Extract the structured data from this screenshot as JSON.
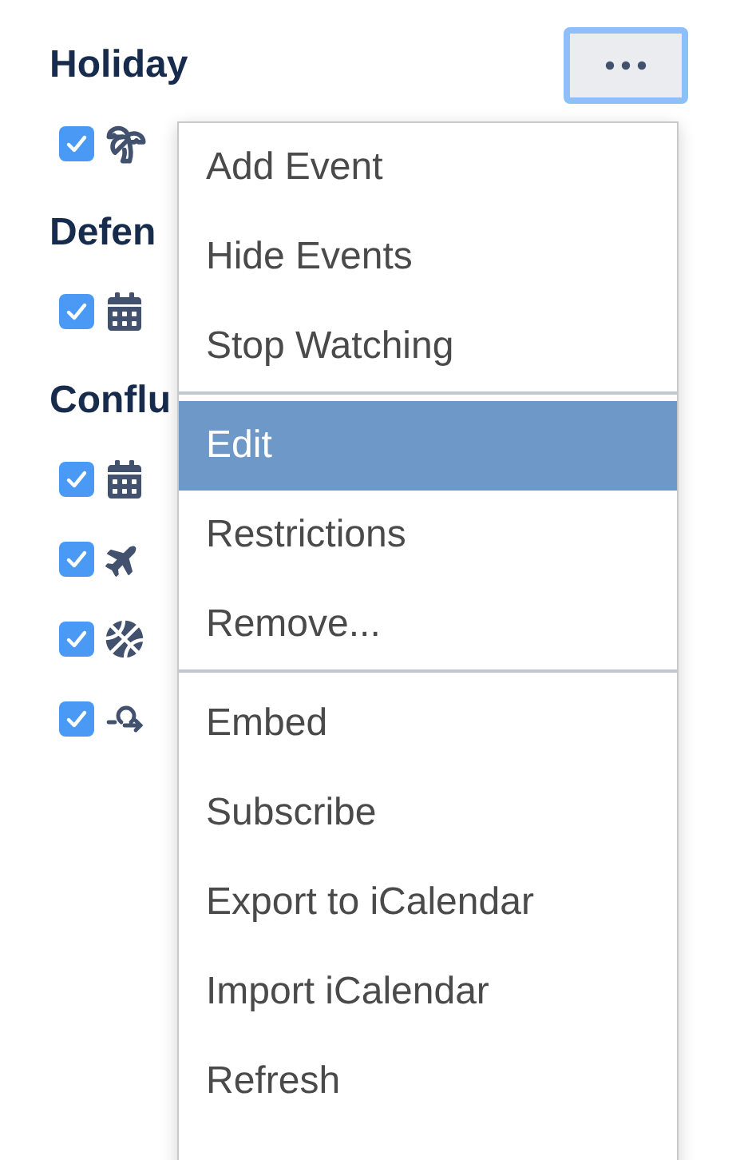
{
  "groups": [
    {
      "heading": "Holiday",
      "calendars": [
        {
          "checked": true
        }
      ]
    },
    {
      "heading": "Defen",
      "calendars": [
        {
          "checked": true
        }
      ]
    },
    {
      "heading": "Conflu",
      "calendars": [
        {
          "checked": true
        },
        {
          "checked": true
        },
        {
          "checked": true
        },
        {
          "checked": true
        }
      ]
    }
  ],
  "menu": {
    "sections": [
      [
        {
          "label": "Add Event",
          "selected": false
        },
        {
          "label": "Hide Events",
          "selected": false
        },
        {
          "label": "Stop Watching",
          "selected": false
        }
      ],
      [
        {
          "label": "Edit",
          "selected": true
        },
        {
          "label": "Restrictions",
          "selected": false
        },
        {
          "label": "Remove...",
          "selected": false
        }
      ],
      [
        {
          "label": "Embed",
          "selected": false
        },
        {
          "label": "Subscribe",
          "selected": false
        },
        {
          "label": "Export to iCalendar",
          "selected": false
        },
        {
          "label": "Import iCalendar",
          "selected": false
        },
        {
          "label": "Refresh",
          "selected": false
        }
      ]
    ]
  }
}
